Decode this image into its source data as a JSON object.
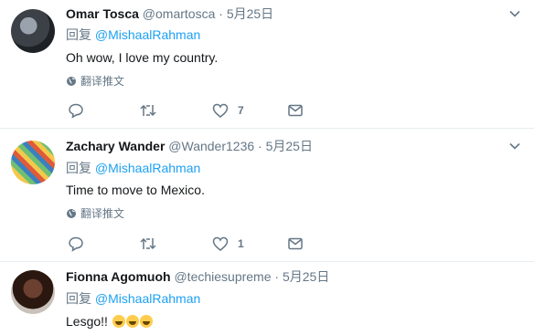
{
  "tweets": [
    {
      "name": "Omar Tosca",
      "handle": "@omartosca",
      "separator": "·",
      "date": "5月25日",
      "reply_prefix": "回复",
      "reply_to": "@MishaalRahman",
      "text": "Oh wow, I love my country.",
      "translate_label": "翻译推文",
      "likes": "7"
    },
    {
      "name": "Zachary Wander",
      "handle": "@Wander1236",
      "separator": "·",
      "date": "5月25日",
      "reply_prefix": "回复",
      "reply_to": "@MishaalRahman",
      "text": "Time to move to Mexico.",
      "translate_label": "翻译推文",
      "likes": "1"
    },
    {
      "name": "Fionna Agomuoh",
      "handle": "@techiesupreme",
      "separator": "·",
      "date": "5月25日",
      "reply_prefix": "回复",
      "reply_to": "@MishaalRahman",
      "text": "Lesgo!!",
      "emojis": [
        "rolling-on-floor-laughing",
        "rolling-on-floor-laughing",
        "rolling-on-floor-laughing"
      ]
    }
  ],
  "colors": {
    "link": "#1da1f2",
    "secondary_text": "#657786",
    "divider": "#e6ecf0"
  }
}
